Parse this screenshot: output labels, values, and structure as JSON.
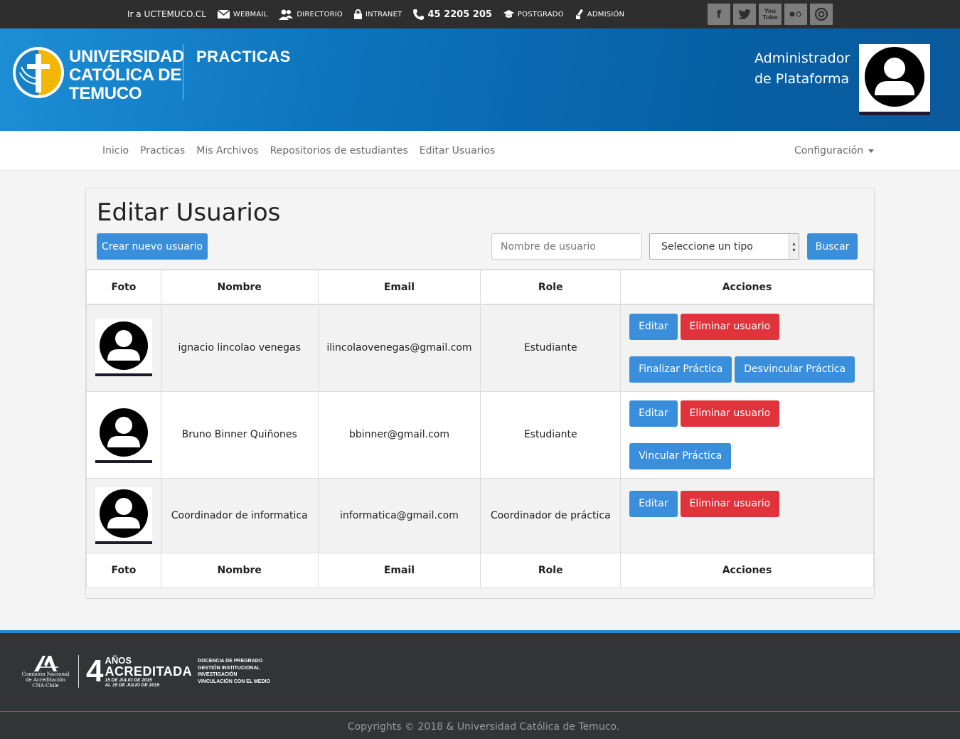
{
  "topbar": {
    "links": [
      "Ir a UCTEMUCO.CL",
      "WEBMAIL",
      "DIRECTORIO",
      "INTRANET",
      "45 2205 205",
      "POSTGRADO",
      "ADMISIÓN"
    ],
    "socials": [
      "f",
      "t",
      "You Tube",
      "flickr",
      "issuu"
    ]
  },
  "header": {
    "logo_lines": [
      "UNIVERSIDAD",
      "CATÓLICA DE",
      "TEMUCO"
    ],
    "site_title": "PRACTICAS",
    "admin_name_line1": "Administrador",
    "admin_name_line2": "de Plataforma"
  },
  "nav": {
    "items": [
      "Inicio",
      "Practicas",
      "Mis Archivos",
      "Repositorios de estudiantes",
      "Editar Usuarios"
    ],
    "config": "Configuración"
  },
  "page": {
    "title": "Editar Usuarios",
    "create_button": "Crear nuevo usuario",
    "search_placeholder": "Nombre de usuario",
    "select_value": "Seleccione un tipo",
    "search_button": "Buscar"
  },
  "table": {
    "headers": [
      "Foto",
      "Nombre",
      "Email",
      "Role",
      "Acciones"
    ],
    "rows": [
      {
        "name": "ignacio lincolao venegas",
        "email": "ilincolaovenegas@gmail.com",
        "role": "Estudiante",
        "actions_row1": [
          "Editar",
          "Eliminar usuario"
        ],
        "actions_row2": [
          "Finalizar Práctica",
          "Desvincular Práctica"
        ]
      },
      {
        "name": "Bruno Binner Quiñones",
        "email": "bbinner@gmail.com",
        "role": "Estudiante",
        "actions_row1": [
          "Editar",
          "Eliminar usuario"
        ],
        "actions_row2": [
          "Vincular Práctica"
        ]
      },
      {
        "name": "Coordinador de informatica",
        "email": "informatica@gmail.com",
        "role": "Coordinador de práctica",
        "actions_row1": [
          "Editar",
          "Eliminar usuario"
        ],
        "actions_row2": []
      }
    ]
  },
  "footer": {
    "cna_lines": [
      "Comisión Nacional",
      "de Acreditación",
      "CNA-Chile"
    ],
    "acr_number": "4",
    "acr_anos": "AÑOS",
    "acr_word": "ACREDITADA",
    "acr_dates": [
      "15 DE JULIO DE 2015",
      "AL 15 DE JULIO DE 2019"
    ],
    "acr_areas": [
      "DOCENCIA DE PREGRADO",
      "GESTIÓN INSTITUCIONAL",
      "INVESTIGACIÓN",
      "VINCULACIÓN CON EL MEDIO"
    ],
    "copyright": "Copyrights © 2018 & Universidad Católica de Temuco."
  },
  "colors": {
    "primary_button": "#3a8fdc",
    "danger_button": "#e0333b",
    "topbar": "#2e2e2e",
    "footer_accent": "#2c84c9"
  }
}
